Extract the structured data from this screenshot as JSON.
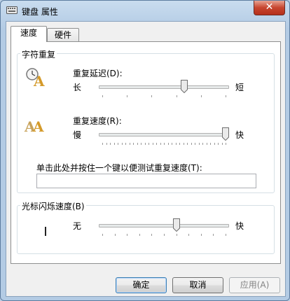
{
  "window": {
    "title": "键盘 属性",
    "close_glyph": "✕"
  },
  "tabs": [
    {
      "label": "速度",
      "active": true
    },
    {
      "label": "硬件",
      "active": false
    }
  ],
  "char_repeat": {
    "group_title": "字符重复",
    "delay": {
      "label": "重复延迟(D):",
      "min_label": "长",
      "max_label": "短",
      "value": 0.667
    },
    "rate": {
      "label": "重复速度(R):",
      "min_label": "慢",
      "max_label": "快",
      "value": 1.0
    },
    "test": {
      "label": "单击此处并按住一个键以便测试重复速度(T):",
      "value": ""
    }
  },
  "cursor_blink": {
    "group_title": "光标闪烁速度(B)",
    "min_label": "无",
    "max_label": "快",
    "value": 0.6
  },
  "buttons": {
    "ok": "确定",
    "cancel": "取消",
    "apply": "应用(A)"
  },
  "icons": {
    "title": "keyboard-icon",
    "delay": "clock-a-icon",
    "rate": "double-a-icon",
    "blink": "text-cursor-icon"
  }
}
